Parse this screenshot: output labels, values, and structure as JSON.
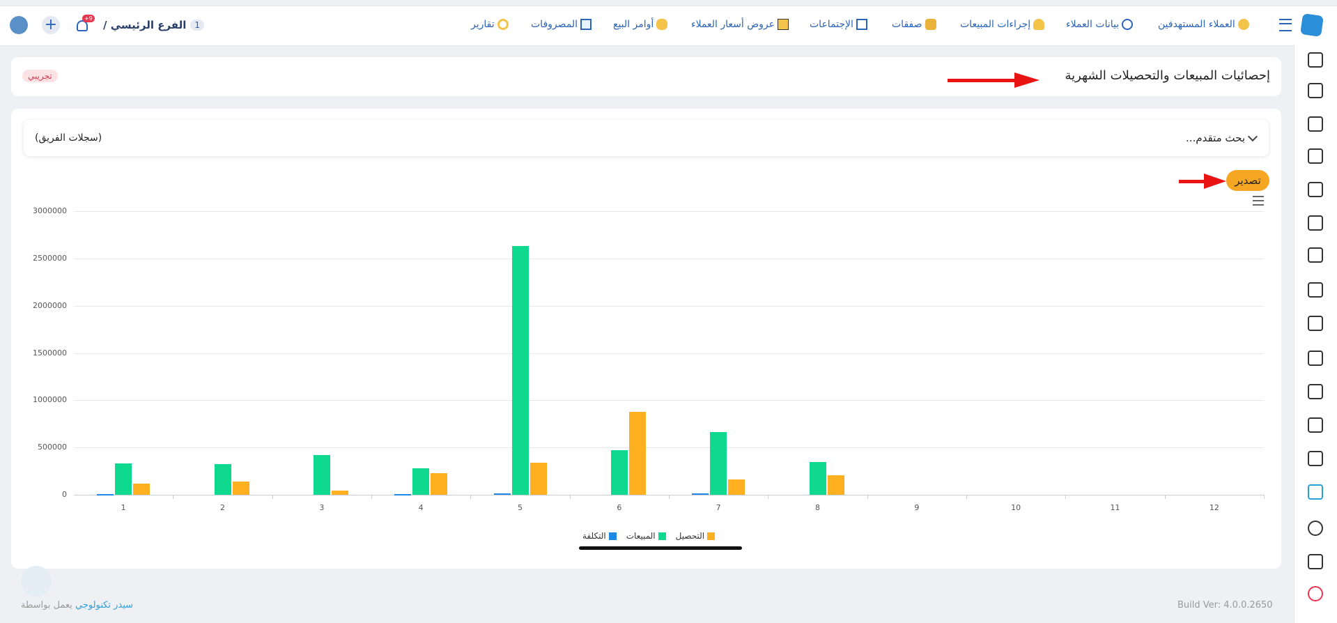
{
  "nav": {
    "branch_count": "1",
    "branch_label": "الفرع الرئيسي /",
    "notification_count": "+9",
    "items": [
      {
        "label": "العملاء المستهدفين",
        "icon": "target-customers-icon"
      },
      {
        "label": "بيانات العملاء",
        "icon": "customer-data-icon"
      },
      {
        "label": "إجراءات المبيعات",
        "icon": "sales-actions-icon"
      },
      {
        "label": "صفقات",
        "icon": "deals-icon"
      },
      {
        "label": "الإجتماعات",
        "icon": "meetings-icon"
      },
      {
        "label": "عروض أسعار العملاء",
        "icon": "quotes-icon"
      },
      {
        "label": "أوامر البيع",
        "icon": "sales-orders-icon"
      },
      {
        "label": "المصروفات",
        "icon": "expenses-icon"
      },
      {
        "label": "تقارير",
        "icon": "reports-icon"
      }
    ]
  },
  "page": {
    "title": "إحصائيات المبيعات والتحصيلات الشهرية",
    "badge": "تجريبي"
  },
  "filter": {
    "advanced_search": "بحث متقدم...",
    "team_records": "(سجلات الفريق)"
  },
  "export_label": "تصدير",
  "footer": {
    "build": "Build Ver: 4.0.0.2650",
    "powered_prefix": "يعمل بواسطة",
    "powered_brand": "سيدر تكنولوجي"
  },
  "colors": {
    "cost": "#1e88e5",
    "sales": "#0fd98e",
    "collection": "#ffb020",
    "accent": "#2a63b8",
    "export": "#f5a623",
    "badge_bg": "#fde2e4",
    "badge_text": "#d9344a"
  },
  "chart_data": {
    "type": "bar",
    "categories": [
      "1",
      "2",
      "3",
      "4",
      "5",
      "6",
      "7",
      "8",
      "9",
      "10",
      "11",
      "12"
    ],
    "ylim": [
      0,
      3000000
    ],
    "yticks": [
      "0",
      "500000",
      "1000000",
      "1500000",
      "2000000",
      "2500000",
      "3000000"
    ],
    "series": [
      {
        "name": "التكلفة",
        "color": "#1e88e5",
        "values": [
          10000,
          0,
          0,
          10000,
          15000,
          0,
          15000,
          0,
          0,
          0,
          0,
          0
        ]
      },
      {
        "name": "المبيعات",
        "color": "#0fd98e",
        "values": [
          330000,
          325000,
          420000,
          280000,
          2630000,
          475000,
          660000,
          345000,
          0,
          0,
          0,
          0
        ]
      },
      {
        "name": "التحصيل",
        "color": "#ffb020",
        "values": [
          120000,
          140000,
          45000,
          225000,
          340000,
          880000,
          160000,
          210000,
          0,
          0,
          0,
          0
        ]
      }
    ],
    "legend_position": "bottom"
  }
}
